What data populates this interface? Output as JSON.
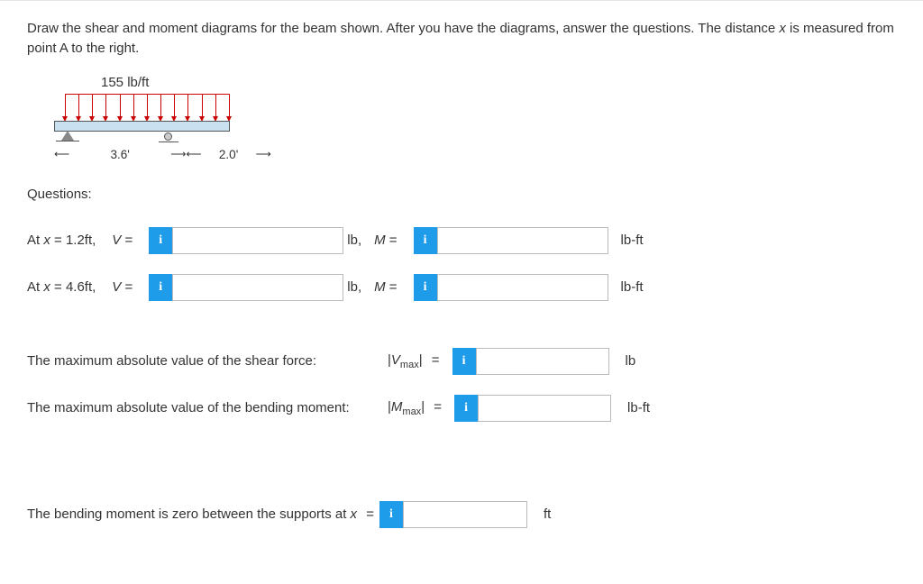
{
  "intro": {
    "line1": "Draw the shear and moment diagrams for the beam shown. After you have the diagrams, answer the questions. The distance ",
    "xvar": "x",
    "line2": " is measured from point A to the right."
  },
  "diagram": {
    "load": "155 lb/ft",
    "span1": "3.6'",
    "span2": "2.0'"
  },
  "questions_header": "Questions:",
  "q1": {
    "prefix": "At ",
    "xvar": "x",
    "xeq": " = 1.2ft,",
    "Vlabel": "V",
    "eq": " =",
    "v_value": "",
    "v_unit": "lb",
    "comma": ",",
    "Mlabel": "M",
    "m_value": "",
    "m_unit": "lb-ft"
  },
  "q2": {
    "prefix": "At ",
    "xvar": "x",
    "xeq": " = 4.6ft,",
    "Vlabel": "V",
    "eq": " =",
    "v_value": "",
    "v_unit": "lb",
    "comma": ",",
    "Mlabel": "M",
    "m_value": "",
    "m_unit": "lb-ft"
  },
  "max_shear": {
    "prompt": "The maximum absolute value of the shear force:",
    "sym_open": "|",
    "sym_V": "V",
    "sym_sub": "max",
    "sym_close": "|",
    "eq": " =",
    "value": "",
    "unit": "lb"
  },
  "max_moment": {
    "prompt": "The maximum absolute value of the bending moment:",
    "sym_open": "|",
    "sym_M": "M",
    "sym_sub": "max",
    "sym_close": "|",
    "eq": " =",
    "value": "",
    "unit": "lb-ft"
  },
  "zero_moment": {
    "prompt": "The bending moment is zero between the supports at ",
    "xvar": "x",
    "eq": " =",
    "value": "",
    "unit": "ft"
  },
  "info_glyph": "i"
}
